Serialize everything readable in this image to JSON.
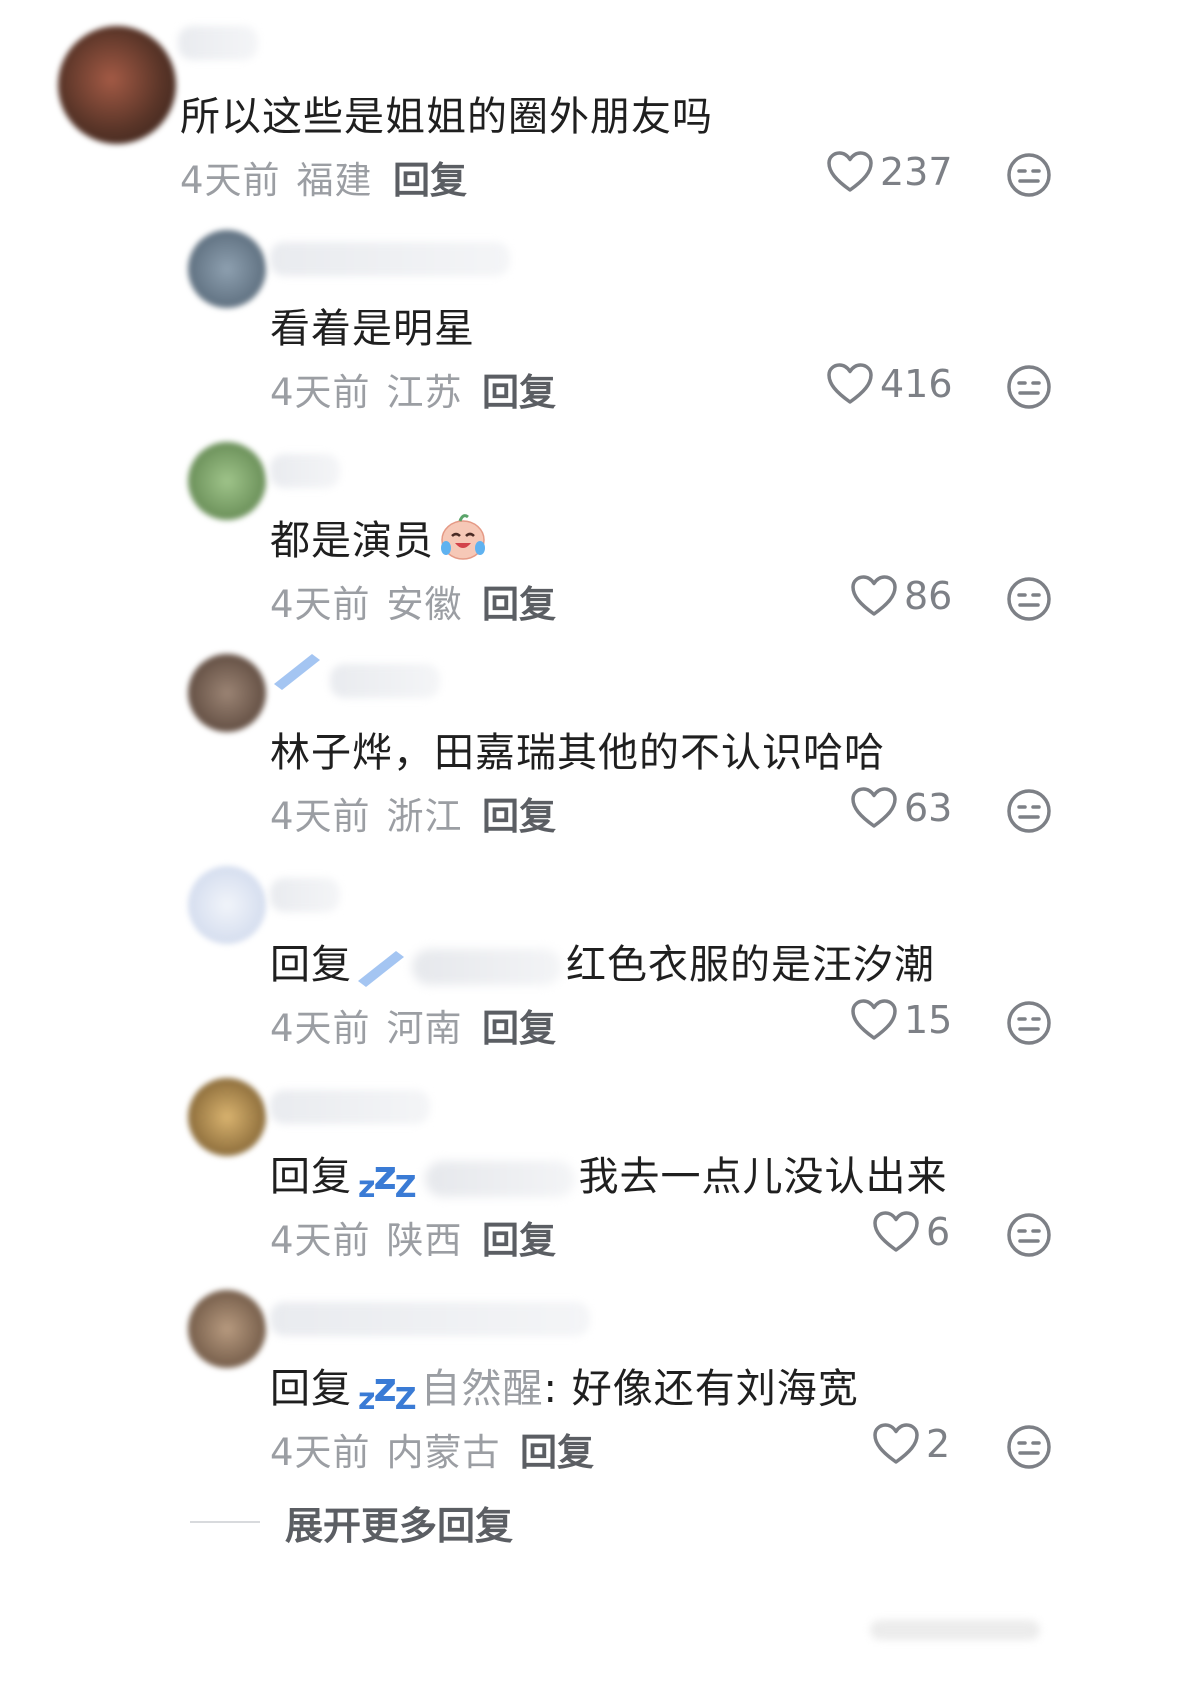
{
  "comments": [
    {
      "avatar_color": "#6b3a2c",
      "text": "所以这些是姐姐的圈外朋友吗",
      "time": "4天前",
      "region": "福建",
      "reply_label": "回复",
      "likes": "237"
    },
    {
      "avatar_color": "#5d6f7f",
      "text": "看着是明星",
      "time": "4天前",
      "region": "江苏",
      "reply_label": "回复",
      "likes": "416"
    },
    {
      "avatar_color": "#6f9a5a",
      "text": "都是演员",
      "time": "4天前",
      "region": "安徽",
      "reply_label": "回复",
      "likes": "86"
    },
    {
      "avatar_color": "#6b5448",
      "text": "林子烨，田嘉瑞其他的不认识哈哈",
      "time": "4天前",
      "region": "浙江",
      "reply_label": "回复",
      "likes": "63"
    },
    {
      "avatar_color": "#dfe6f3",
      "reply_prefix": "回复",
      "text": "红色衣服的是汪汐潮",
      "time": "4天前",
      "region": "河南",
      "reply_label": "回复",
      "likes": "15"
    },
    {
      "avatar_color": "#a8844a",
      "reply_prefix": "回复",
      "text": "我去一点儿没认出来",
      "time": "4天前",
      "region": "陕西",
      "reply_label": "回复",
      "likes": "6"
    },
    {
      "avatar_color": "#8a6f55",
      "reply_prefix": "回复",
      "reply_to_name": "自然醒",
      "text": ": 好像还有刘海宽",
      "time": "4天前",
      "region": "内蒙古",
      "reply_label": "回复",
      "likes": "2"
    }
  ],
  "expand_label": "展开更多回复",
  "icons": {
    "like": "heart-outline-icon",
    "dislike": "neutral-face-icon",
    "emoji": "crying-laughing-face-icon",
    "zzz": "sleeping-zzz-icon",
    "pencil": "blue-pencil-icon"
  },
  "colors": {
    "accent_zzz": "#3a7bd5",
    "meta_grey": "#9b9ea3"
  }
}
